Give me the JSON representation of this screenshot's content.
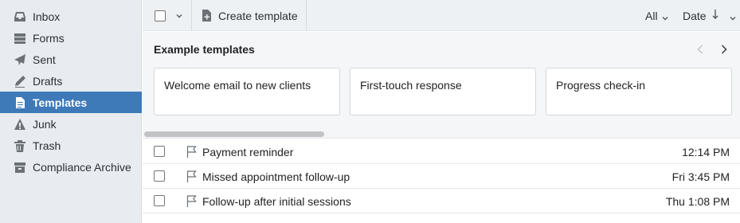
{
  "sidebar": {
    "items": [
      {
        "label": "Inbox",
        "icon": "inbox-icon",
        "active": false
      },
      {
        "label": "Forms",
        "icon": "forms-icon",
        "active": false
      },
      {
        "label": "Sent",
        "icon": "sent-icon",
        "active": false
      },
      {
        "label": "Drafts",
        "icon": "drafts-icon",
        "active": false
      },
      {
        "label": "Templates",
        "icon": "templates-icon",
        "active": true
      },
      {
        "label": "Junk",
        "icon": "junk-icon",
        "active": false
      },
      {
        "label": "Trash",
        "icon": "trash-icon",
        "active": false
      },
      {
        "label": "Compliance Archive",
        "icon": "archive-icon",
        "active": false
      }
    ],
    "active_color": "#3e7ab8"
  },
  "toolbar": {
    "create_label": "Create template",
    "filter_label": "All",
    "sort_label": "Date"
  },
  "examples": {
    "title": "Example templates",
    "cards": [
      {
        "label": "Welcome email to new clients"
      },
      {
        "label": "First-touch response"
      },
      {
        "label": "Progress check-in"
      }
    ]
  },
  "templates": [
    {
      "subject": "Payment reminder",
      "time": "12:14 PM"
    },
    {
      "subject": "Missed appointment follow-up",
      "time": "Fri 3:45 PM"
    },
    {
      "subject": "Follow-up after initial sessions",
      "time": "Thu 1:08 PM"
    }
  ]
}
